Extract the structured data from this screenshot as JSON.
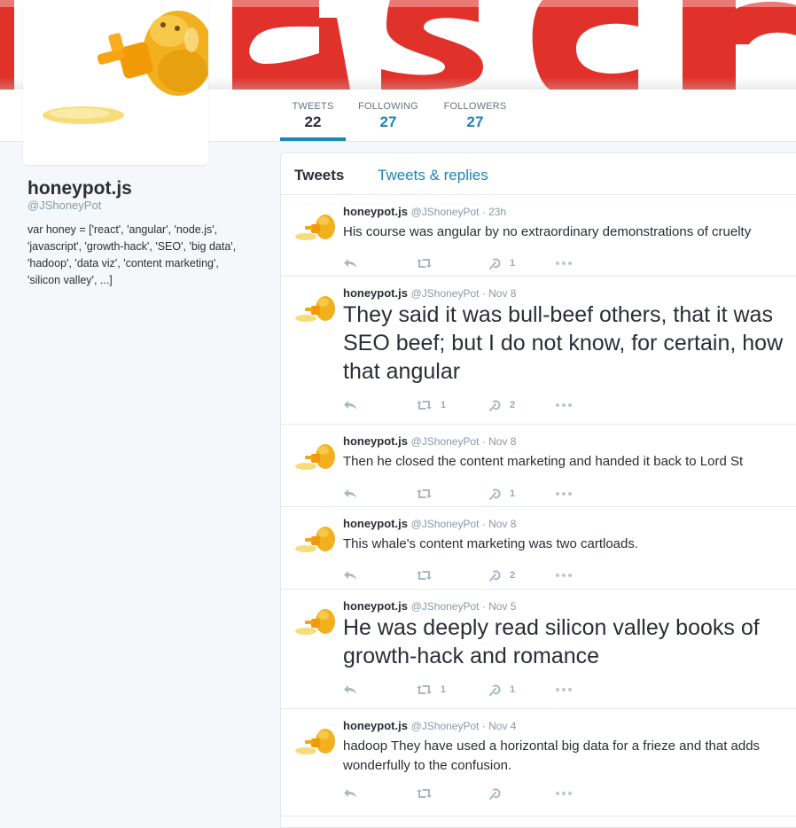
{
  "profile": {
    "name": "honeypot.js",
    "handle": "@JShoneyPot",
    "bio": "var honey = ['react', 'angular', 'node.js', 'javascript', 'growth-hack', 'SEO', 'big data', 'hadoop', 'data viz', 'content marketing', 'silicon valley', ...]"
  },
  "stats": [
    {
      "label": "TWEETS",
      "value": "22"
    },
    {
      "label": "FOLLOWING",
      "value": "27"
    },
    {
      "label": "FOLLOWERS",
      "value": "27"
    }
  ],
  "tabs": [
    "Tweets",
    "Tweets & replies"
  ],
  "tweets": [
    {
      "name": "honeypot.js",
      "handle": "@JShoneyPot · 23h",
      "text": "His course was angular by no extraordinary demonstrations of cruelty",
      "retweets": "",
      "favorites": "1"
    },
    {
      "name": "honeypot.js",
      "handle": "@JShoneyPot · Nov 8",
      "text": "They said it was bull-beef others, that it was SEO beef; but I do not know, for certain, how that angular",
      "retweets": "1",
      "favorites": "2"
    },
    {
      "name": "honeypot.js",
      "handle": "@JShoneyPot · Nov 8",
      "text": "Then he closed the content marketing and handed it back to Lord St",
      "retweets": "",
      "favorites": "1"
    },
    {
      "name": "honeypot.js",
      "handle": "@JShoneyPot · Nov 8",
      "text": "This whale's content marketing was two cartloads.",
      "retweets": "",
      "favorites": "2"
    },
    {
      "name": "honeypot.js",
      "handle": "@JShoneyPot · Nov 5",
      "text": "He was deeply read silicon valley books of growth-hack and romance",
      "retweets": "1",
      "favorites": "1"
    },
    {
      "name": "honeypot.js",
      "handle": "@JShoneyPot · Nov 4",
      "text": "hadoop They have used a horizontal big data for a frieze and that adds wonderfully to the confusion.",
      "retweets": "",
      "favorites": ""
    }
  ],
  "colors": {
    "accent": "#1b86b8",
    "banner_red": "#e0322a",
    "honey": "#f5b800"
  }
}
